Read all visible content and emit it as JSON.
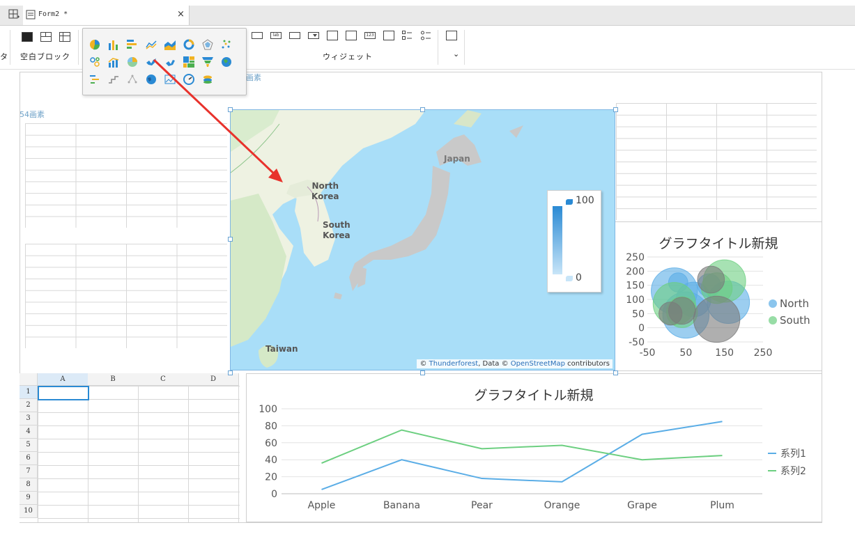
{
  "tab": {
    "title": "Form2 *",
    "close": "×"
  },
  "ribbon": {
    "group_blank": "空白ブロック",
    "group_widget": "ウィジェット",
    "left_cut": "タ",
    "expand": "⌄"
  },
  "labels": {
    "el1": "54画素",
    "el2": "画素"
  },
  "map": {
    "labels": {
      "north_korea": "North\nKorea",
      "south_korea": "South\nKorea",
      "japan": "Japan",
      "taiwan": "Taiwan"
    },
    "legend": {
      "max": "100",
      "min": "0"
    },
    "attribution": {
      "prefix": "© ",
      "provider": "Thunderforest",
      "mid": ", Data © ",
      "osm": "OpenStreetMap",
      "suffix": " contributors"
    }
  },
  "sheet": {
    "columns": [
      "A",
      "B",
      "C",
      "D"
    ],
    "rows": [
      "1",
      "2",
      "3",
      "4",
      "5",
      "6",
      "7",
      "8",
      "9",
      "10"
    ]
  },
  "colors": {
    "accent": "#2a8ad4",
    "series1": "#5aade6",
    "series2": "#6ccf80",
    "north": "#5aade6",
    "south": "#6ccf80",
    "neutral": "#7a7a7a"
  },
  "chart_data": [
    {
      "type": "scatter",
      "subtype": "bubble",
      "title": "グラフタイトル新規",
      "xlim": [
        -50,
        250
      ],
      "ylim": [
        -50,
        250
      ],
      "xticks": [
        "-50",
        "50",
        "150",
        "250"
      ],
      "yticks": [
        "250",
        "200",
        "150",
        "100",
        "50",
        "0",
        "-50"
      ],
      "legend_position": "right",
      "series": [
        {
          "name": "North",
          "points": [
            {
              "x": 20,
              "y": 130,
              "r": 60
            },
            {
              "x": 50,
              "y": 45,
              "r": 60
            },
            {
              "x": 160,
              "y": 90,
              "r": 55
            },
            {
              "x": 70,
              "y": 100,
              "r": 45
            },
            {
              "x": 30,
              "y": 160,
              "r": 25
            },
            {
              "x": 110,
              "y": 150,
              "r": 30
            }
          ]
        },
        {
          "name": "South",
          "points": [
            {
              "x": 20,
              "y": 85,
              "r": 55
            },
            {
              "x": 150,
              "y": 165,
              "r": 55
            },
            {
              "x": 40,
              "y": 55,
              "r": 40
            },
            {
              "x": 130,
              "y": 140,
              "r": 40
            }
          ]
        },
        {
          "points": [
            {
              "x": 10,
              "y": 50,
              "r": 30
            },
            {
              "x": 40,
              "y": 60,
              "r": 35
            },
            {
              "x": 115,
              "y": 170,
              "r": 35
            },
            {
              "x": 130,
              "y": 30,
              "r": 60
            }
          ]
        }
      ]
    },
    {
      "type": "line",
      "title": "グラフタイトル新規",
      "categories": [
        "Apple",
        "Banana",
        "Pear",
        "Orange",
        "Grape",
        "Plum"
      ],
      "ylim": [
        0,
        100
      ],
      "yticks": [
        "100",
        "80",
        "60",
        "40",
        "20",
        "0"
      ],
      "legend_position": "right",
      "series": [
        {
          "name": "系列1",
          "values": [
            5,
            40,
            18,
            14,
            70,
            85
          ]
        },
        {
          "name": "系列2",
          "values": [
            36,
            75,
            53,
            57,
            40,
            45
          ]
        }
      ]
    }
  ]
}
